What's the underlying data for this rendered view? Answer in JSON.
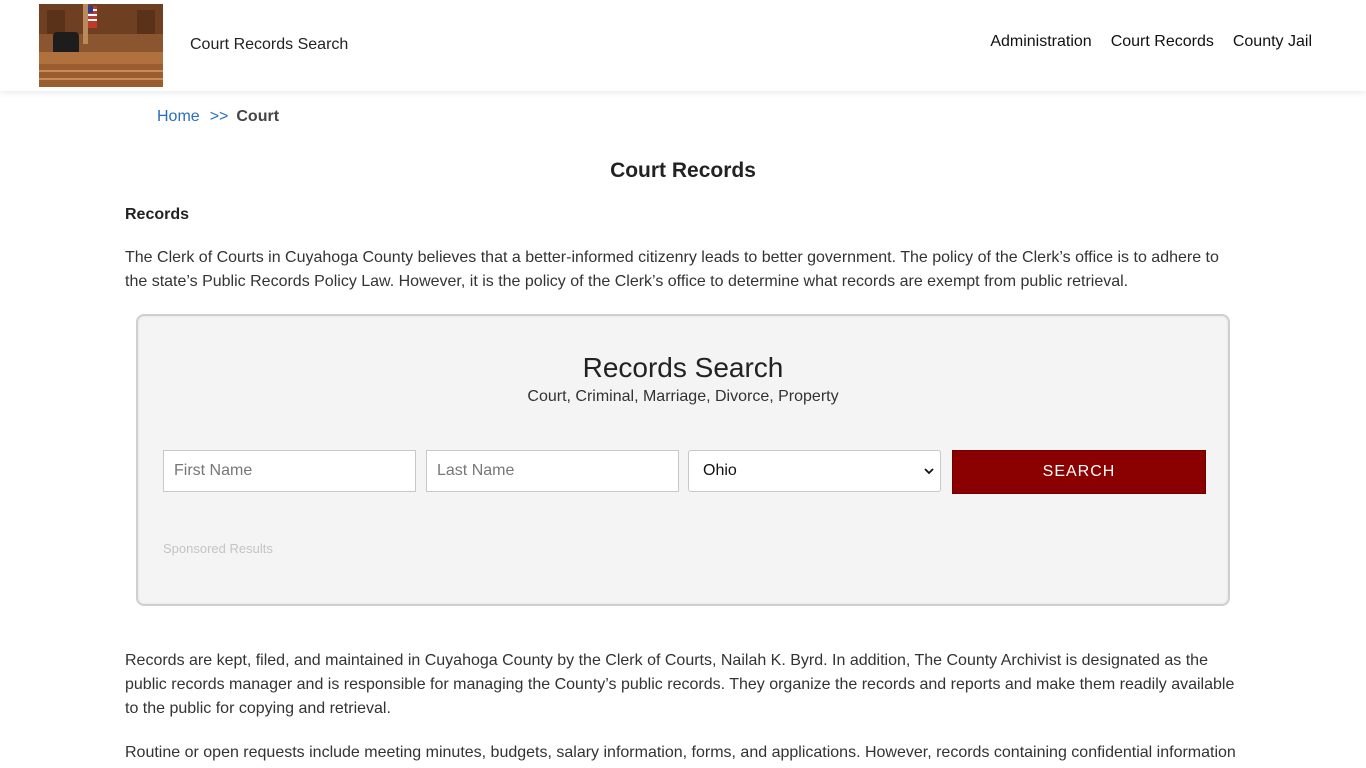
{
  "header": {
    "site_title": "Court Records Search",
    "nav": [
      "Administration",
      "Court Records",
      "County Jail"
    ]
  },
  "breadcrumb": {
    "home": "Home",
    "separator": ">>",
    "current": "Court"
  },
  "page_title": "Court Records",
  "section_heading": "Records",
  "paragraph_1": "The Clerk of Courts in Cuyahoga County believes that a better-informed citizenry leads to better government. The policy of the Clerk’s office is to adhere to the state’s Public Records Policy Law. However, it is the policy of the Clerk’s office to determine what records are exempt from public retrieval.",
  "search": {
    "title": "Records Search",
    "subtitle": "Court, Criminal, Marriage, Divorce, Property",
    "first_name_placeholder": "First Name",
    "last_name_placeholder": "Last Name",
    "state_selected": "Ohio",
    "button_label": "SEARCH",
    "sponsored_label": "Sponsored Results",
    "button_color": "#8b0000"
  },
  "paragraph_2": "Records are kept, filed, and maintained in Cuyahoga County by the Clerk of Courts, Nailah K. Byrd. In addition, The County Archivist is designated as the public records manager and is responsible for managing the County’s public records. They organize the records and reports and make them readily available to the public for copying and retrieval.",
  "paragraph_3": "Routine or open requests include meeting minutes, budgets, salary information, forms, and applications. However, records containing confidential information"
}
